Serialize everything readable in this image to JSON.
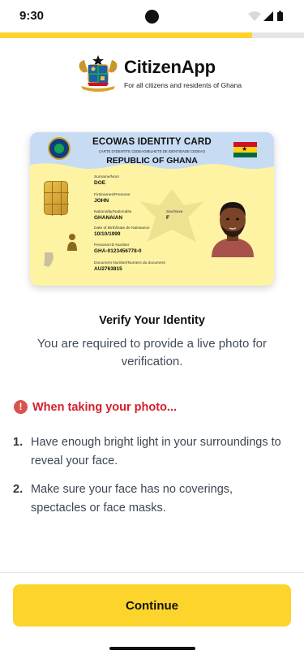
{
  "status_bar": {
    "time": "9:30"
  },
  "progress": {
    "fraction": 0.83,
    "color": "#fcd42c"
  },
  "logo": {
    "app_name": "CitizenApp",
    "tagline": "For all citizens and residents of Ghana"
  },
  "id_card": {
    "title": "ECOWAS IDENTITY CARD",
    "subtitle": "CARTE D'IDENTITE CEDEAO/BILHETE DE IDENTIDADE CEDEAO",
    "country": "REPUBLIC OF GHANA",
    "fields": {
      "surname_label": "Surname/Nom",
      "surname": "DOE",
      "firstnames_label": "Firstnames/Prenoms",
      "firstnames": "JOHN",
      "nationality_label": "Nationality/Nationalite",
      "nationality": "GHANAIAN",
      "sex_label": "Sex/Sexe",
      "sex": "F",
      "dob_label": "Date of Birth/Date de Naissance",
      "dob": "10/10/1999",
      "pin_label": "Personal ID Number",
      "pin": "GHA-0123456778-0",
      "doc_number_label": "Document Number/Numero du document",
      "doc_number": "AU2763815"
    },
    "colors": {
      "background": "#fdf3a3",
      "header": "#c7dcf3",
      "flag_red": "#ce1126",
      "flag_gold": "#fcd116",
      "flag_green": "#006b3f"
    }
  },
  "verify": {
    "title": "Verify Your Identity",
    "description": "You are  required to provide a live photo for verification."
  },
  "warning": {
    "icon": "exclamation-circle-icon",
    "text": "When taking your photo..."
  },
  "tips": [
    {
      "number": "1.",
      "text": "Have enough bright light in your surroundings to reveal your face."
    },
    {
      "number": "2.",
      "text": "Make sure your face has no coverings, spectacles or face masks."
    }
  ],
  "footer": {
    "continue_label": "Continue"
  }
}
